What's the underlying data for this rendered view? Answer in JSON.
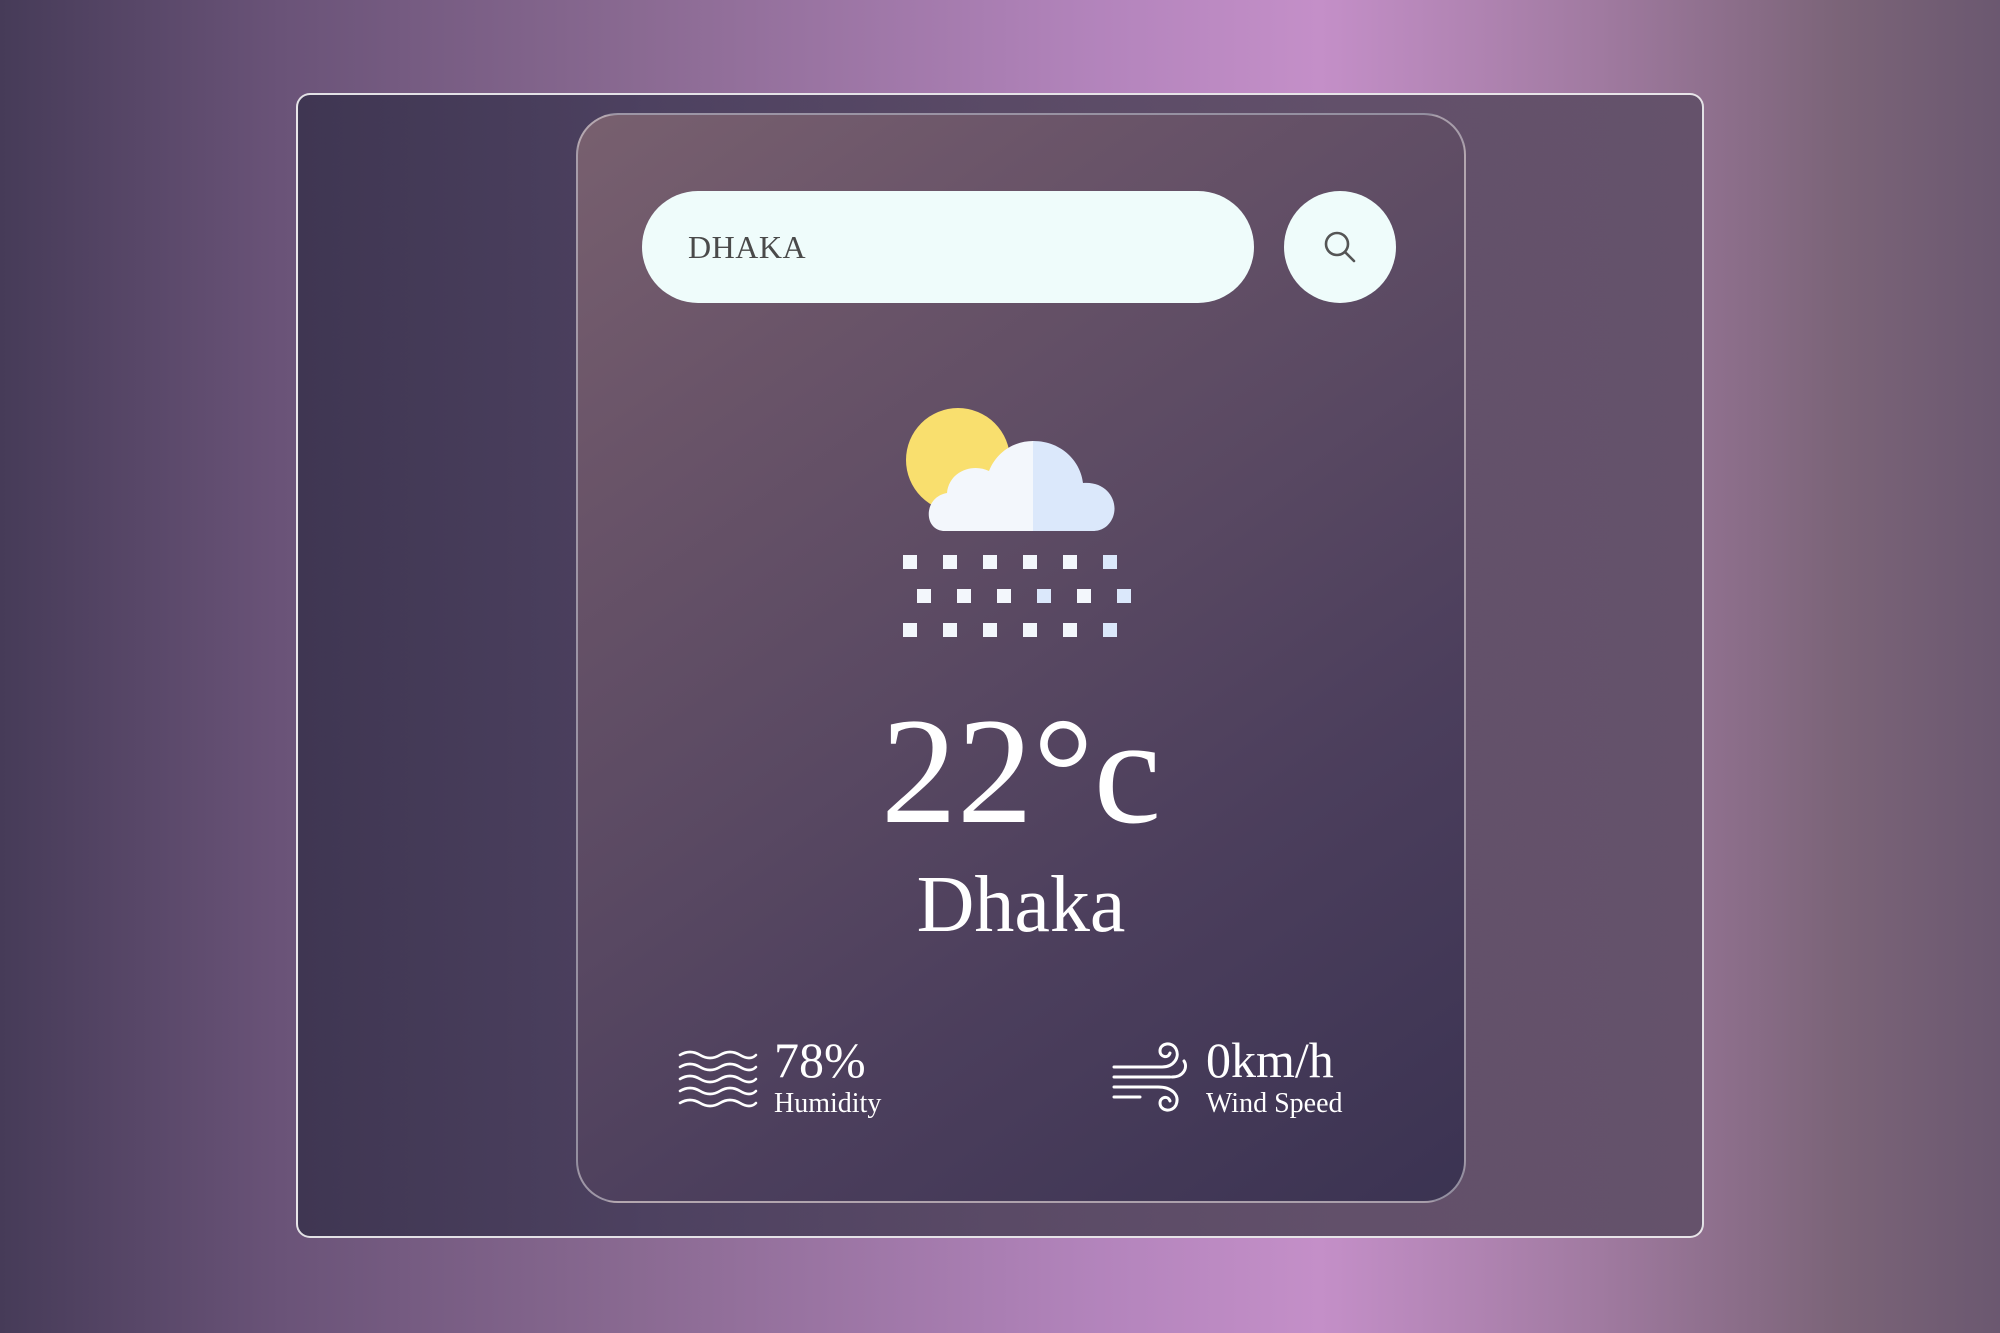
{
  "search": {
    "value": "DHAKA",
    "placeholder": "",
    "button_icon": "search-icon"
  },
  "weather": {
    "condition_icon": "sun-cloud-snow-icon",
    "temperature": "22°c",
    "city": "Dhaka"
  },
  "details": {
    "humidity": {
      "icon": "humidity-waves-icon",
      "value": "78%",
      "label": "Humidity"
    },
    "wind": {
      "icon": "wind-icon",
      "value": "0km/h",
      "label": "Wind Speed"
    }
  },
  "colors": {
    "card_text": "#ffffff",
    "input_background": "#effcfb",
    "sun": "#f9df6e",
    "cloud_light": "#f3f7fc",
    "cloud_shade": "#dbe8fb"
  }
}
